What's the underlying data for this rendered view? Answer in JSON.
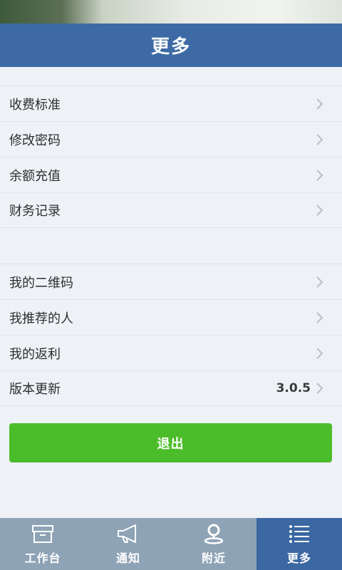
{
  "header": {
    "title": "更多"
  },
  "group1": [
    {
      "label": "收费标准"
    },
    {
      "label": "修改密码"
    },
    {
      "label": "余额充值"
    },
    {
      "label": "财务记录"
    }
  ],
  "group2": [
    {
      "label": "我的二维码"
    },
    {
      "label": "我推荐的人"
    },
    {
      "label": "我的返利"
    },
    {
      "label": "版本更新",
      "value": "3.0.5"
    }
  ],
  "logout": {
    "label": "退出"
  },
  "tabs": [
    {
      "label": "工作台",
      "icon": "archive-box-icon",
      "active": false
    },
    {
      "label": "通知",
      "icon": "megaphone-icon",
      "active": false
    },
    {
      "label": "附近",
      "icon": "location-pin-icon",
      "active": false
    },
    {
      "label": "更多",
      "icon": "menu-list-icon",
      "active": true
    }
  ],
  "colors": {
    "header": "#3d6aa5",
    "background": "#eef2f7",
    "logout_button": "#4cbd2a",
    "tab_bar": "#8fa3b6",
    "tab_active": "#3b67a2"
  }
}
